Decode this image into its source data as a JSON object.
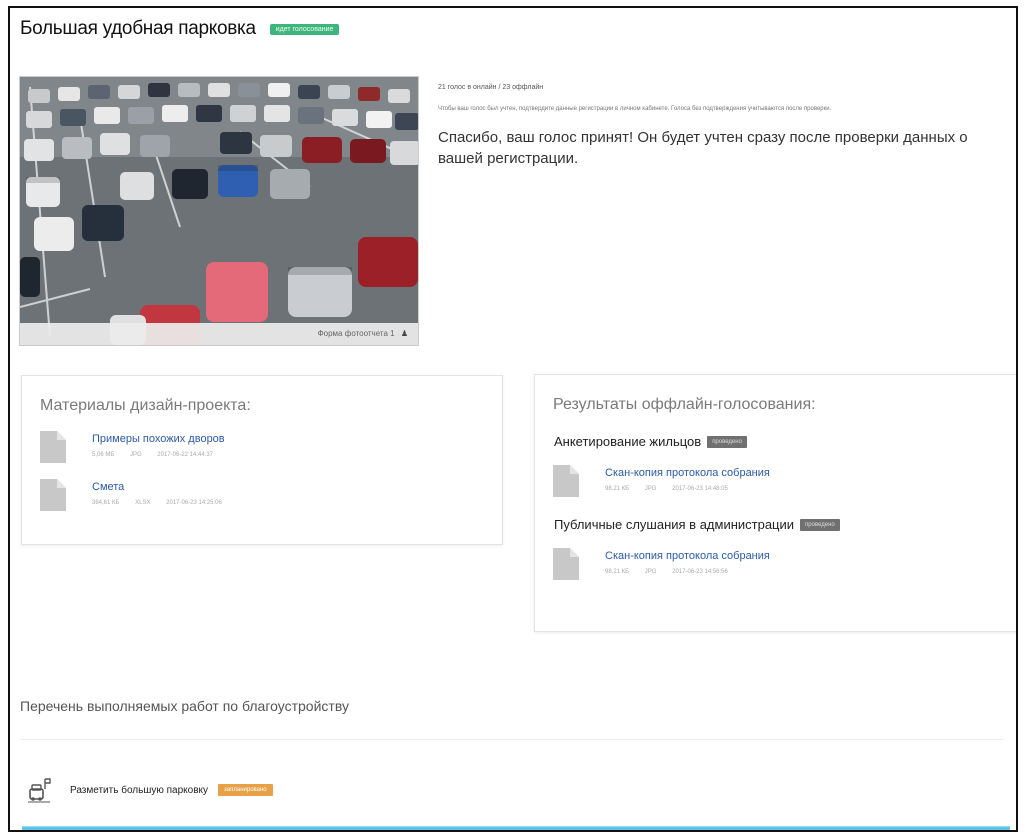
{
  "page": {
    "title": "Большая удобная парковка",
    "status_badge": "идет голосование"
  },
  "photo": {
    "caption": "Форма фотоотчета 1",
    "caption_icon": "user-icon"
  },
  "info": {
    "votes_line": "21 голос в онлайн / 23 оффлайн",
    "hint": "Чтобы ваш голос был учтен, подтвердите данные регистрации в личном кабинете. Голоса без подтверждения учитываются после проверки.",
    "thanks": "Спасибо, ваш голос принят! Он будет учтен сразу после проверки данных о вашей регистрации."
  },
  "materials": {
    "title": "Материалы дизайн-проекта:",
    "files": [
      {
        "name": "Примеры похожих дворов",
        "size": "5,06 МБ",
        "type": "JPG",
        "date": "2017-06-22 14:44:37"
      },
      {
        "name": "Смета",
        "size": "384,61 КБ",
        "type": "XLSX",
        "date": "2017-06-23 14:25:06"
      }
    ]
  },
  "results": {
    "title": "Результаты оффлайн-голосования:",
    "groups": [
      {
        "label": "Анкетирование жильцов",
        "tag": "проведено",
        "file": {
          "name": "Скан-копия протокола собрания",
          "size": "98,21 КБ",
          "type": "JPG",
          "date": "2017-06-23 14:48:05"
        }
      },
      {
        "label": "Публичные слушания в администрации",
        "tag": "проведено",
        "file": {
          "name": "Скан-копия протокола собрания",
          "size": "98,21 КБ",
          "type": "JPG",
          "date": "2017-06-23 14:56:56"
        }
      }
    ]
  },
  "works": {
    "heading": "Перечень выполняемых работ по благоустройству",
    "items": [
      {
        "label": "Разметить большую парковку",
        "tag": "запланировано",
        "icon": "parking-lines-icon"
      }
    ]
  },
  "colors": {
    "badge_green": "#3fb57e",
    "link_blue": "#2b5aa8",
    "tag_orange": "#e7a146",
    "tag_gray": "#707070",
    "bottom_bar": "#5dc3e6"
  }
}
